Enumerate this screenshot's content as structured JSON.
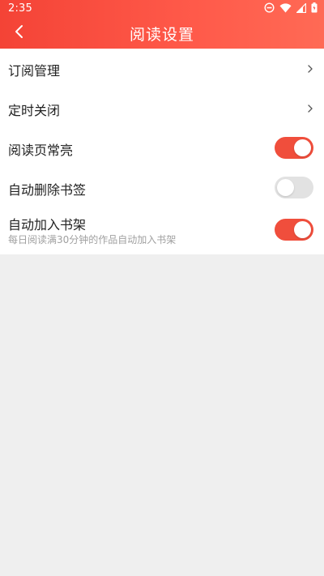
{
  "status_bar": {
    "time": "2:35",
    "icons": [
      "do-not-disturb-icon",
      "wifi-icon",
      "signal-icon",
      "battery-icon"
    ]
  },
  "header": {
    "title": "阅读设置",
    "back_icon": "back-arrow-icon",
    "gradient_start": "#f44336",
    "gradient_end": "#ff6a55"
  },
  "settings": {
    "subscription": {
      "label": "订阅管理",
      "icon": "chevron-right-icon"
    },
    "timer_close": {
      "label": "定时关闭",
      "icon": "chevron-right-icon"
    },
    "keep_screen_on": {
      "label": "阅读页常亮",
      "enabled": true
    },
    "auto_delete_bookmark": {
      "label": "自动删除书签",
      "enabled": false
    },
    "auto_add_shelf": {
      "label": "自动加入书架",
      "description": "每日阅读满30分钟的作品自动加入书架",
      "enabled": true
    }
  },
  "colors": {
    "accent": "#f04e3c",
    "toggle_off": "#e2e2e2",
    "background": "#efefef"
  }
}
